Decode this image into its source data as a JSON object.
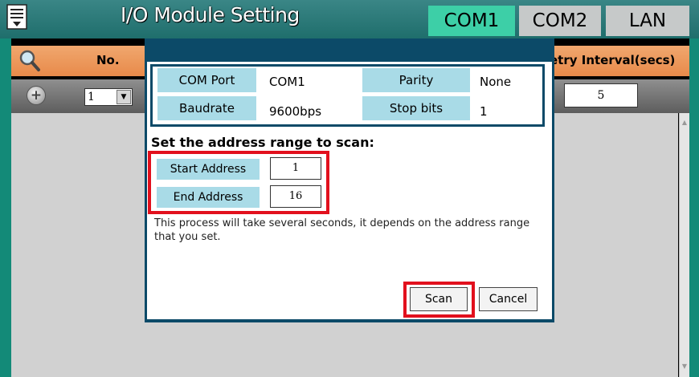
{
  "app": {
    "title": "I/O Module Setting",
    "tabs": [
      {
        "label": "COM1",
        "active": true
      },
      {
        "label": "COM2",
        "active": false
      },
      {
        "label": "LAN",
        "active": false
      }
    ],
    "menu_icon": "menu-list-icon"
  },
  "table": {
    "search_icon": "magnifier-icon",
    "col_no": "No.",
    "col_interval": "etry Interval(secs)",
    "add_icon": "plus-icon",
    "no_value": "1",
    "interval_value": "5"
  },
  "dialog": {
    "com_port_label": "COM Port",
    "com_port_value": "COM1",
    "parity_label": "Parity",
    "parity_value": "None",
    "baudrate_label": "Baudrate",
    "baudrate_value": "9600bps",
    "stop_bits_label": "Stop bits",
    "stop_bits_value": "1",
    "scan_heading": "Set the address range to scan:",
    "start_address_label": "Start Address",
    "start_address_value": "1",
    "end_address_label": "End Address",
    "end_address_value": "16",
    "note": "This process will take several seconds, it depends on the address range that you set.",
    "scan_button": "Scan",
    "cancel_button": "Cancel"
  },
  "colors": {
    "title_bar": "#2a7a78",
    "active_tab": "#3dcfa7",
    "inactive_tab": "#c6c9c9",
    "header_row": "#ec9a5c",
    "dialog_frame": "#0c4a68",
    "label_bg": "#a9dbe7",
    "highlight": "#e2101d"
  }
}
